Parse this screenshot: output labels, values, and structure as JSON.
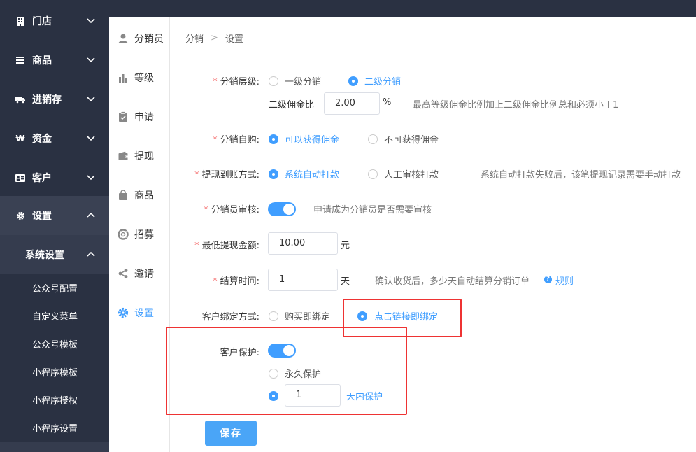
{
  "sidebar": {
    "items": [
      {
        "label": "门店",
        "icon": "building-icon"
      },
      {
        "label": "商品",
        "icon": "list-icon"
      },
      {
        "label": "进销存",
        "icon": "truck-icon"
      },
      {
        "label": "资金",
        "icon": "won-icon"
      },
      {
        "label": "客户",
        "icon": "id-card-icon"
      },
      {
        "label": "设置",
        "icon": "gear-icon"
      }
    ],
    "sub_header": "系统设置",
    "sub_items": [
      "公众号配置",
      "自定义菜单",
      "公众号模板",
      "小程序模板",
      "小程序授权",
      "小程序设置"
    ]
  },
  "subnav": {
    "items": [
      {
        "label": "分销员",
        "icon": "user-icon"
      },
      {
        "label": "等级",
        "icon": "bar-chart-icon"
      },
      {
        "label": "申请",
        "icon": "clipboard-icon"
      },
      {
        "label": "提现",
        "icon": "wallet-icon"
      },
      {
        "label": "商品",
        "icon": "bag-icon"
      },
      {
        "label": "招募",
        "icon": "lifebuoy-icon"
      },
      {
        "label": "邀请",
        "icon": "share-icon"
      },
      {
        "label": "设置",
        "icon": "gear-icon"
      }
    ]
  },
  "breadcrumb": {
    "first": "分销",
    "sep": ">",
    "second": "设置"
  },
  "form": {
    "level": {
      "label": "分销层级:",
      "options": [
        "一级分销",
        "二级分销"
      ],
      "selected": "二级分销",
      "commission_label": "二级佣金比",
      "commission_value": "2.00",
      "commission_unit": "%",
      "hint": "最高等级佣金比例加上二级佣金比例总和必须小于1"
    },
    "self_buy": {
      "label": "分销自购:",
      "options": [
        "可以获得佣金",
        "不可获得佣金"
      ],
      "selected": "可以获得佣金"
    },
    "withdraw": {
      "label": "提现到账方式:",
      "options": [
        "系统自动打款",
        "人工审核打款"
      ],
      "selected": "系统自动打款",
      "hint": "系统自动打款失败后，该笔提现记录需要手动打款"
    },
    "review": {
      "label": "分销员审核:",
      "on": true,
      "hint": "申请成为分销员是否需要审核"
    },
    "min_withdraw": {
      "label": "最低提现金额:",
      "value": "10.00",
      "unit": "元"
    },
    "settle": {
      "label": "结算时间:",
      "value": "1",
      "unit": "天",
      "hint": "确认收货后，多少天自动结算分销订单",
      "help_icon": "?",
      "rule_link": "规则"
    },
    "bind": {
      "label": "客户绑定方式:",
      "options": [
        "购买即绑定",
        "点击链接即绑定"
      ],
      "selected": "点击链接即绑定"
    },
    "protect": {
      "label": "客户保护:",
      "on": true,
      "options": [
        "永久保护"
      ],
      "days_value": "1",
      "days_label": "天内保护"
    },
    "save_label": "保存"
  },
  "colors": {
    "accent": "#409eff",
    "sidebar": "#2a3142",
    "highlight_box": "#e33333",
    "required": "#f56c6c"
  }
}
